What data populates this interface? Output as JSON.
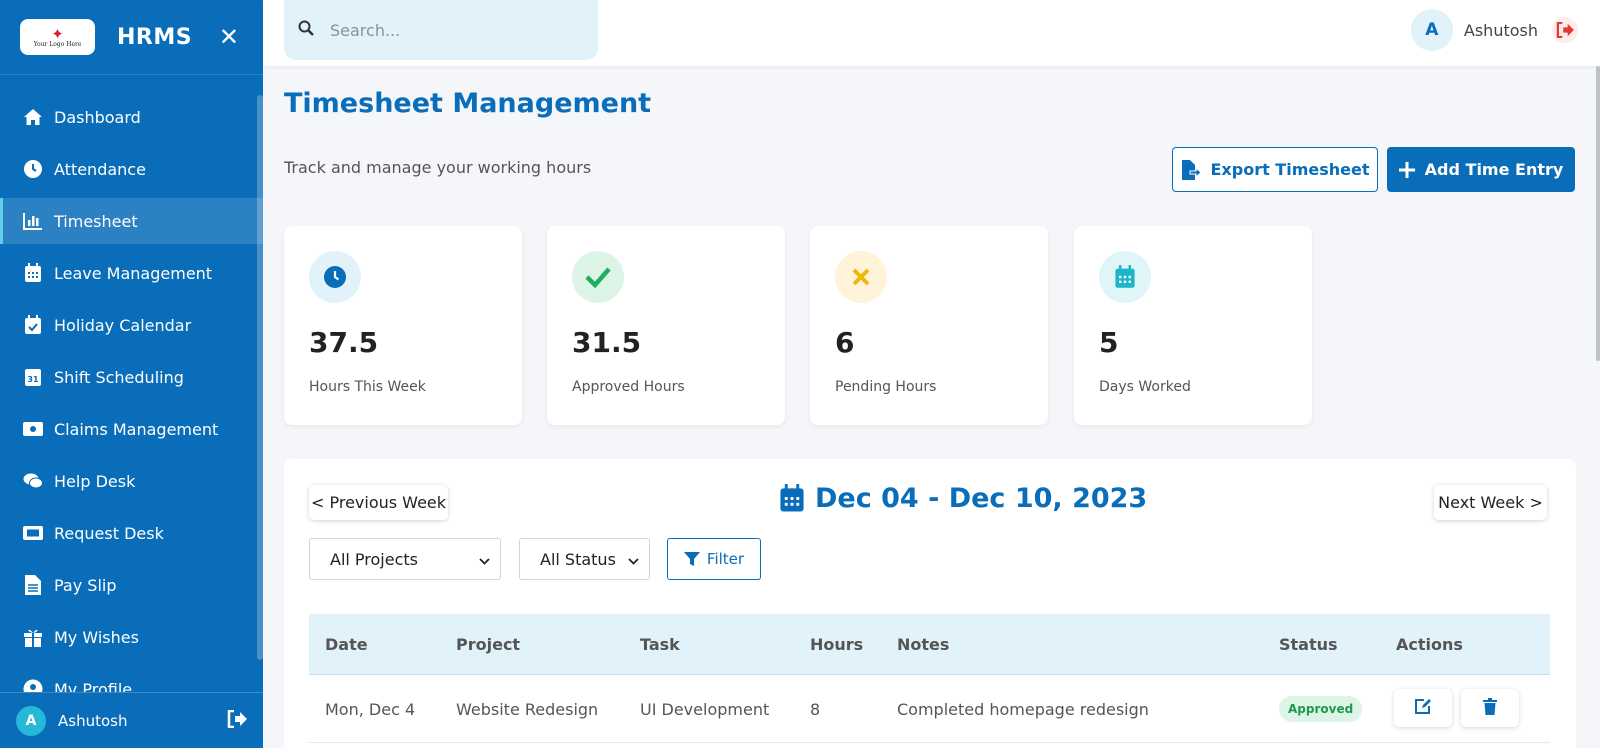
{
  "app": {
    "brand": "HRMS",
    "logo_text": "Your Logo Here"
  },
  "sidebar": {
    "items": [
      {
        "label": "Dashboard",
        "icon": "home-icon"
      },
      {
        "label": "Attendance",
        "icon": "clock-icon"
      },
      {
        "label": "Timesheet",
        "icon": "bar-chart-icon",
        "active": true
      },
      {
        "label": "Leave Management",
        "icon": "calendar-grid-icon"
      },
      {
        "label": "Holiday Calendar",
        "icon": "calendar-check-icon"
      },
      {
        "label": "Shift Scheduling",
        "icon": "calendar-day-icon"
      },
      {
        "label": "Claims Management",
        "icon": "money-bill-icon"
      },
      {
        "label": "Help Desk",
        "icon": "chat-icon"
      },
      {
        "label": "Request Desk",
        "icon": "ticket-icon"
      },
      {
        "label": "Pay Slip",
        "icon": "document-icon"
      },
      {
        "label": "My Wishes",
        "icon": "gift-icon"
      },
      {
        "label": "My Profile",
        "icon": "user-icon"
      }
    ],
    "footer": {
      "avatar_initial": "A",
      "name": "Ashutosh"
    }
  },
  "topbar": {
    "search_placeholder": "Search...",
    "user": {
      "avatar_initial": "A",
      "name": "Ashutosh"
    }
  },
  "page": {
    "title": "Timesheet Management",
    "subtitle": "Track and manage your working hours",
    "export_label": "Export Timesheet",
    "add_label": "Add Time Entry"
  },
  "stats": [
    {
      "value": "37.5",
      "label": "Hours This Week",
      "icon": "clock-icon",
      "color": "#0a6db9",
      "bg": "#e1f2fb"
    },
    {
      "value": "31.5",
      "label": "Approved Hours",
      "icon": "check-icon",
      "color": "#1fae5b",
      "bg": "#dcf5e7"
    },
    {
      "value": "6",
      "label": "Pending Hours",
      "icon": "x-icon",
      "color": "#f2b705",
      "bg": "#fff4d9"
    },
    {
      "value": "5",
      "label": "Days Worked",
      "icon": "calendar-icon",
      "color": "#1bb7c9",
      "bg": "#dff5f8"
    }
  ],
  "week": {
    "prev_label": "< Previous Week",
    "next_label": "Next Week >",
    "range": "Dec 04 - Dec 10, 2023"
  },
  "filters": {
    "project": "All Projects",
    "status": "All Status",
    "filter_label": "Filter"
  },
  "table": {
    "headers": [
      "Date",
      "Project",
      "Task",
      "Hours",
      "Notes",
      "Status",
      "Actions"
    ],
    "rows": [
      {
        "date": "Mon, Dec 4",
        "project": "Website Redesign",
        "task": "UI Development",
        "hours": "8",
        "notes": "Completed homepage redesign",
        "status": "Approved"
      }
    ]
  },
  "colors": {
    "primary": "#0a6db9",
    "approved": "#1c9a4f",
    "danger": "#e53935"
  }
}
